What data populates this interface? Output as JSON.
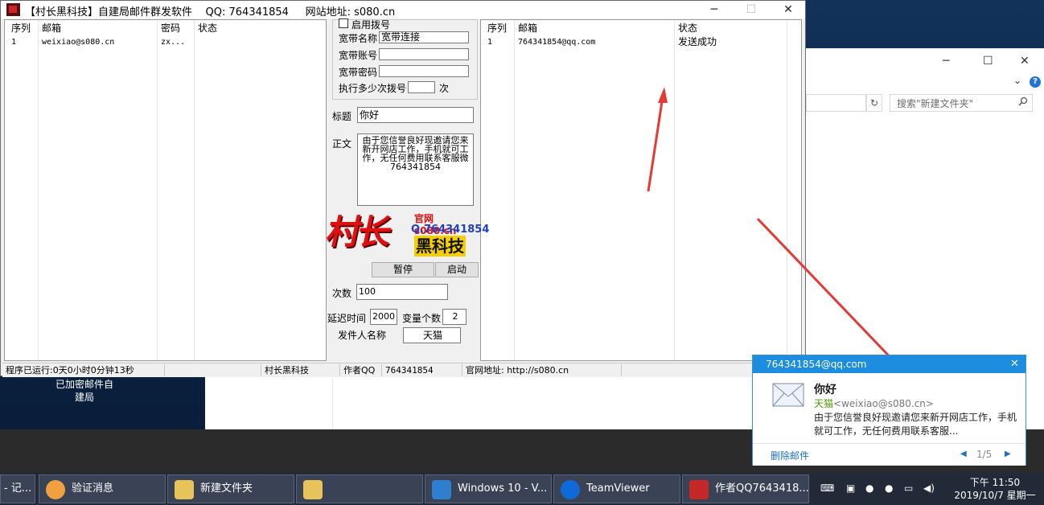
{
  "desktop": {
    "labels": [
      "已加密邮件自",
      "建局"
    ]
  },
  "explorer": {
    "search_placeholder": "搜索\"新建文件夹\"",
    "help": "?",
    "minimize": "─",
    "maximize": "☐",
    "close": "✕",
    "refresh": "↻",
    "chevron": "⌄"
  },
  "app": {
    "title": "【村长黑科技】自建局邮件群发软件    QQ: 764341854     网站地址: s080.cn",
    "window_buttons": {
      "minimize": "─",
      "maximize": "☐",
      "close": "✕"
    },
    "left_list": {
      "headers": [
        "序列",
        "邮箱",
        "密码",
        "状态"
      ],
      "rows": [
        [
          "1",
          "weixiao@s080.cn",
          "zx...",
          ""
        ]
      ]
    },
    "right_list": {
      "headers": [
        "序列",
        "邮箱",
        "状态"
      ],
      "rows": [
        [
          "1",
          "764341854@qq.com",
          "发送成功"
        ]
      ]
    },
    "dialup": {
      "enable_label": "启用拨号",
      "broadband_name_label": "宽带名称",
      "broadband_name_value": "宽带连接",
      "broadband_account_label": "宽带账号",
      "broadband_account_value": "",
      "broadband_password_label": "宽带密码",
      "broadband_password_value": "",
      "dial_times_label": "执行多少次拨号",
      "dial_times_value": "",
      "dial_times_unit": "次"
    },
    "subject_label": "标题",
    "subject_value": "你好",
    "body_label": "正文",
    "body_value": "由于您信誉良好现邀请您来新开网店工作，手机就可工作，无任何费用联系客服微764341854",
    "logo": {
      "site": "官网 s080.cn",
      "qq": "Q.764341854",
      "brand_big": "村长",
      "brand_small": "黑科技"
    },
    "pause_button": "暂停",
    "start_button": "启动",
    "count_label": "次数",
    "count_value": "100",
    "delay_label": "延迟时间",
    "delay_value": "2000",
    "variable_count_label": "变量个数",
    "variable_count_value": "2",
    "sender_name_label": "发件人名称",
    "sender_name_value": "天猫",
    "status_bar": {
      "runtime": "程序已运行:0天0小时0分钟13秒",
      "brand": "村长黑科技",
      "author_label": "作者QQ",
      "author_qq": "764341854",
      "site_label": "官网地址: http://s080.cn"
    }
  },
  "notification": {
    "account": "764341854@qq.com",
    "subject": "你好",
    "sender_name": "天猫",
    "sender_email": "<weixiao@s080.cn>",
    "preview": "由于您信誉良好现邀请您来新开网店工作，手机就可工作，无任何费用联系客服...",
    "delete_label": "删除邮件",
    "pager": "1/5",
    "close": "✕",
    "prev": "◀",
    "next": "▶"
  },
  "taskbar": {
    "items": [
      {
        "label": "- 记..."
      },
      {
        "label": "验证消息"
      },
      {
        "label": "新建文件夹"
      },
      {
        "label": ""
      },
      {
        "label": "Windows 10 - V..."
      },
      {
        "label": "TeamViewer"
      },
      {
        "label": "作者QQ7643418..."
      }
    ],
    "time": "下午 11:50",
    "date": "2019/10/7 星期一"
  },
  "colors": {
    "accent": "#1d8de0",
    "arrow": "#e53935",
    "logo_red": "#e01010",
    "logo_blue": "#1f3fbf"
  }
}
